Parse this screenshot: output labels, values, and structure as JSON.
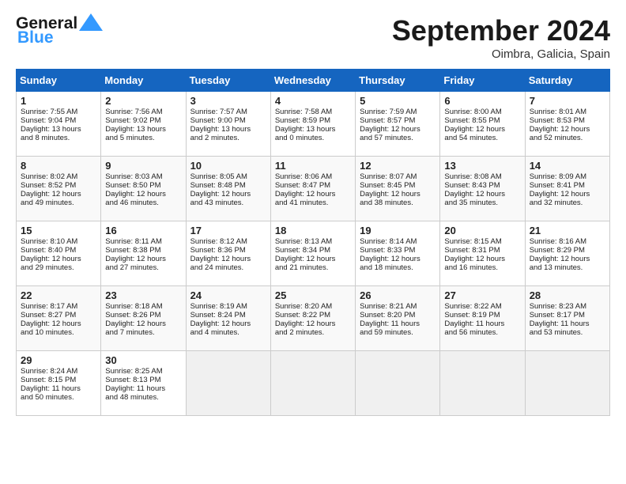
{
  "header": {
    "logo_line1": "General",
    "logo_line2": "Blue",
    "month_title": "September 2024",
    "subtitle": "Oimbra, Galicia, Spain"
  },
  "columns": [
    "Sunday",
    "Monday",
    "Tuesday",
    "Wednesday",
    "Thursday",
    "Friday",
    "Saturday"
  ],
  "weeks": [
    [
      {
        "day": 1,
        "lines": [
          "Sunrise: 7:55 AM",
          "Sunset: 9:04 PM",
          "Daylight: 13 hours",
          "and 8 minutes."
        ]
      },
      {
        "day": 2,
        "lines": [
          "Sunrise: 7:56 AM",
          "Sunset: 9:02 PM",
          "Daylight: 13 hours",
          "and 5 minutes."
        ]
      },
      {
        "day": 3,
        "lines": [
          "Sunrise: 7:57 AM",
          "Sunset: 9:00 PM",
          "Daylight: 13 hours",
          "and 2 minutes."
        ]
      },
      {
        "day": 4,
        "lines": [
          "Sunrise: 7:58 AM",
          "Sunset: 8:59 PM",
          "Daylight: 13 hours",
          "and 0 minutes."
        ]
      },
      {
        "day": 5,
        "lines": [
          "Sunrise: 7:59 AM",
          "Sunset: 8:57 PM",
          "Daylight: 12 hours",
          "and 57 minutes."
        ]
      },
      {
        "day": 6,
        "lines": [
          "Sunrise: 8:00 AM",
          "Sunset: 8:55 PM",
          "Daylight: 12 hours",
          "and 54 minutes."
        ]
      },
      {
        "day": 7,
        "lines": [
          "Sunrise: 8:01 AM",
          "Sunset: 8:53 PM",
          "Daylight: 12 hours",
          "and 52 minutes."
        ]
      }
    ],
    [
      {
        "day": 8,
        "lines": [
          "Sunrise: 8:02 AM",
          "Sunset: 8:52 PM",
          "Daylight: 12 hours",
          "and 49 minutes."
        ]
      },
      {
        "day": 9,
        "lines": [
          "Sunrise: 8:03 AM",
          "Sunset: 8:50 PM",
          "Daylight: 12 hours",
          "and 46 minutes."
        ]
      },
      {
        "day": 10,
        "lines": [
          "Sunrise: 8:05 AM",
          "Sunset: 8:48 PM",
          "Daylight: 12 hours",
          "and 43 minutes."
        ]
      },
      {
        "day": 11,
        "lines": [
          "Sunrise: 8:06 AM",
          "Sunset: 8:47 PM",
          "Daylight: 12 hours",
          "and 41 minutes."
        ]
      },
      {
        "day": 12,
        "lines": [
          "Sunrise: 8:07 AM",
          "Sunset: 8:45 PM",
          "Daylight: 12 hours",
          "and 38 minutes."
        ]
      },
      {
        "day": 13,
        "lines": [
          "Sunrise: 8:08 AM",
          "Sunset: 8:43 PM",
          "Daylight: 12 hours",
          "and 35 minutes."
        ]
      },
      {
        "day": 14,
        "lines": [
          "Sunrise: 8:09 AM",
          "Sunset: 8:41 PM",
          "Daylight: 12 hours",
          "and 32 minutes."
        ]
      }
    ],
    [
      {
        "day": 15,
        "lines": [
          "Sunrise: 8:10 AM",
          "Sunset: 8:40 PM",
          "Daylight: 12 hours",
          "and 29 minutes."
        ]
      },
      {
        "day": 16,
        "lines": [
          "Sunrise: 8:11 AM",
          "Sunset: 8:38 PM",
          "Daylight: 12 hours",
          "and 27 minutes."
        ]
      },
      {
        "day": 17,
        "lines": [
          "Sunrise: 8:12 AM",
          "Sunset: 8:36 PM",
          "Daylight: 12 hours",
          "and 24 minutes."
        ]
      },
      {
        "day": 18,
        "lines": [
          "Sunrise: 8:13 AM",
          "Sunset: 8:34 PM",
          "Daylight: 12 hours",
          "and 21 minutes."
        ]
      },
      {
        "day": 19,
        "lines": [
          "Sunrise: 8:14 AM",
          "Sunset: 8:33 PM",
          "Daylight: 12 hours",
          "and 18 minutes."
        ]
      },
      {
        "day": 20,
        "lines": [
          "Sunrise: 8:15 AM",
          "Sunset: 8:31 PM",
          "Daylight: 12 hours",
          "and 16 minutes."
        ]
      },
      {
        "day": 21,
        "lines": [
          "Sunrise: 8:16 AM",
          "Sunset: 8:29 PM",
          "Daylight: 12 hours",
          "and 13 minutes."
        ]
      }
    ],
    [
      {
        "day": 22,
        "lines": [
          "Sunrise: 8:17 AM",
          "Sunset: 8:27 PM",
          "Daylight: 12 hours",
          "and 10 minutes."
        ]
      },
      {
        "day": 23,
        "lines": [
          "Sunrise: 8:18 AM",
          "Sunset: 8:26 PM",
          "Daylight: 12 hours",
          "and 7 minutes."
        ]
      },
      {
        "day": 24,
        "lines": [
          "Sunrise: 8:19 AM",
          "Sunset: 8:24 PM",
          "Daylight: 12 hours",
          "and 4 minutes."
        ]
      },
      {
        "day": 25,
        "lines": [
          "Sunrise: 8:20 AM",
          "Sunset: 8:22 PM",
          "Daylight: 12 hours",
          "and 2 minutes."
        ]
      },
      {
        "day": 26,
        "lines": [
          "Sunrise: 8:21 AM",
          "Sunset: 8:20 PM",
          "Daylight: 11 hours",
          "and 59 minutes."
        ]
      },
      {
        "day": 27,
        "lines": [
          "Sunrise: 8:22 AM",
          "Sunset: 8:19 PM",
          "Daylight: 11 hours",
          "and 56 minutes."
        ]
      },
      {
        "day": 28,
        "lines": [
          "Sunrise: 8:23 AM",
          "Sunset: 8:17 PM",
          "Daylight: 11 hours",
          "and 53 minutes."
        ]
      }
    ],
    [
      {
        "day": 29,
        "lines": [
          "Sunrise: 8:24 AM",
          "Sunset: 8:15 PM",
          "Daylight: 11 hours",
          "and 50 minutes."
        ]
      },
      {
        "day": 30,
        "lines": [
          "Sunrise: 8:25 AM",
          "Sunset: 8:13 PM",
          "Daylight: 11 hours",
          "and 48 minutes."
        ]
      },
      null,
      null,
      null,
      null,
      null
    ]
  ]
}
